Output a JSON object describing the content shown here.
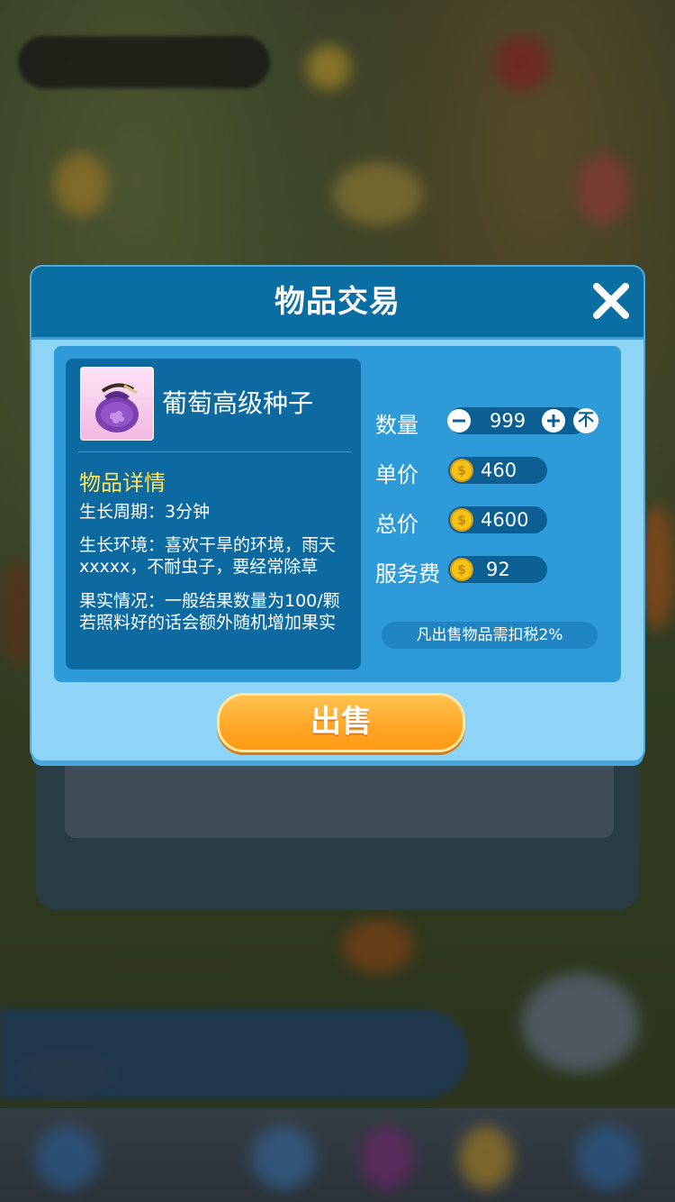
{
  "dialog": {
    "title": "物品交易"
  },
  "item": {
    "name": "葡萄高级种子",
    "detail_title": "物品详情",
    "growth_cycle": "生长周期：3分钟",
    "environment_line1": "生长环境：喜欢干旱的环境，雨天",
    "environment_line2": "xxxxx，不耐虫子，要经常除草",
    "fruit_line1": "果实情况：一般结果数量为100/颗",
    "fruit_line2": "若照料好的话会额外随机增加果实"
  },
  "trade": {
    "quantity_label": "数量",
    "quantity_value": "999",
    "max_button_label": "不",
    "unit_price_label": "单价",
    "unit_price_value": "460",
    "total_price_label": "总价",
    "total_price_value": "4600",
    "service_fee_label": "服务费",
    "service_fee_value": "92",
    "tax_note": "凡出售物品需扣税2%"
  },
  "actions": {
    "sell_label": "出售"
  },
  "colors": {
    "header": "#0b6ea3",
    "dialog_bg": "#8ed4f7",
    "content_bg": "#2e9bd8",
    "card_bg": "#0d6aa1",
    "detail_title": "#ffe45a",
    "sell_button": "#ffa526"
  },
  "icons": {
    "close": "close-icon",
    "coin": "coin-icon",
    "minus": "minus-icon",
    "plus": "plus-icon",
    "item": "seed-bag-icon"
  }
}
